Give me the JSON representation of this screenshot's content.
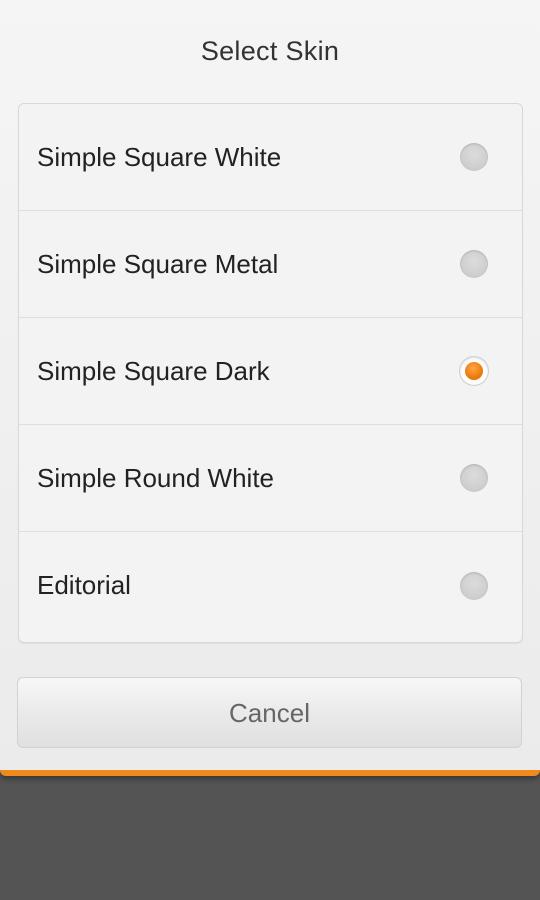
{
  "dialog": {
    "title": "Select Skin",
    "options": [
      {
        "label": "Simple Square White",
        "selected": false
      },
      {
        "label": "Simple Square Metal",
        "selected": false
      },
      {
        "label": "Simple Square Dark",
        "selected": true
      },
      {
        "label": "Simple Round White",
        "selected": false
      },
      {
        "label": "Editorial",
        "selected": false
      }
    ],
    "cancel_label": "Cancel"
  },
  "colors": {
    "accent": "#f08a1c",
    "backdrop": "#545454"
  }
}
